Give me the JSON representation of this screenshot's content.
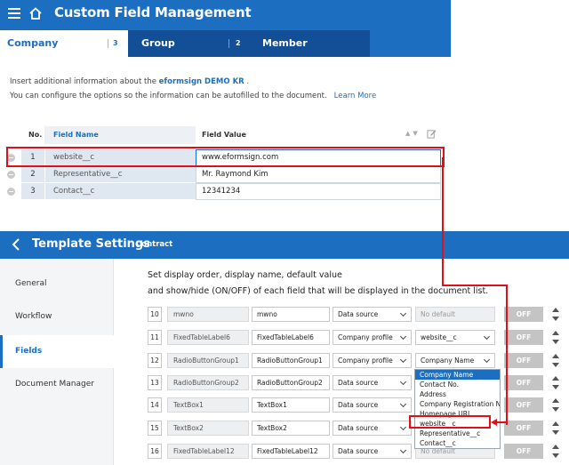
{
  "cfm": {
    "title": "Custom Field Management",
    "tabs": [
      {
        "label": "Company",
        "count": "3"
      },
      {
        "label": "Group",
        "count": "2"
      },
      {
        "label": "Member"
      }
    ],
    "desc_prefix": "Insert additional information about the ",
    "desc_company": "eformsign DEMO KR",
    "desc_suffix": " .",
    "desc_line2": "You can configure the options so the information can be autofilled to the document.",
    "learn_more": "Learn More",
    "table": {
      "headers": {
        "no": "No.",
        "name": "Field Name",
        "value": "Field Value"
      },
      "rows": [
        {
          "no": "1",
          "name": "website__c",
          "value": "www.eformsign.com"
        },
        {
          "no": "2",
          "name": "Representative__c",
          "value": "Mr. Raymond Kim"
        },
        {
          "no": "3",
          "name": "Contact__c",
          "value": "12341234"
        }
      ]
    }
  },
  "ts": {
    "title": "Template Settings",
    "subtitle": "Contract",
    "sidebar": [
      "General",
      "Workflow",
      "Fields",
      "Document Manager"
    ],
    "desc_line1": "Set display order, display name, default value",
    "desc_line2": "and show/hide (ON/OFF) of each field that will be displayed in the document list.",
    "rows": [
      {
        "num": "10",
        "orig": "mwno",
        "disp": "mwno",
        "source": "Data source",
        "default": "No default",
        "toggle": "OFF"
      },
      {
        "num": "11",
        "orig": "FixedTableLabel6",
        "disp": "FixedTableLabel6",
        "source": "Company profile",
        "default": "website__c",
        "toggle": "OFF"
      },
      {
        "num": "12",
        "orig": "RadioButtonGroup1",
        "disp": "RadioButtonGroup1",
        "source": "Company profile",
        "default": "Company Name",
        "toggle": "OFF"
      },
      {
        "num": "13",
        "orig": "RadioButtonGroup2",
        "disp": "RadioButtonGroup2",
        "source": "Data source",
        "default": "",
        "toggle": "OFF"
      },
      {
        "num": "14",
        "orig": "TextBox1",
        "disp": "TextBox1",
        "source": "Data source",
        "default": "",
        "toggle": "OFF"
      },
      {
        "num": "15",
        "orig": "TextBox2",
        "disp": "TextBox2",
        "source": "Data source",
        "default": "",
        "toggle": "OFF"
      },
      {
        "num": "16",
        "orig": "FixedTableLabel12",
        "disp": "FixedTableLabel12",
        "source": "Data source",
        "default": "No default",
        "toggle": "OFF"
      }
    ],
    "dropdown": [
      "Company Name",
      "Contact No.",
      "Address",
      "Company Registration No.",
      "Homepage URL",
      "website__c",
      "Representative__c",
      "Contact__c"
    ]
  },
  "colors": {
    "brand": "#1c6fc0",
    "highlight": "#e0101b"
  }
}
